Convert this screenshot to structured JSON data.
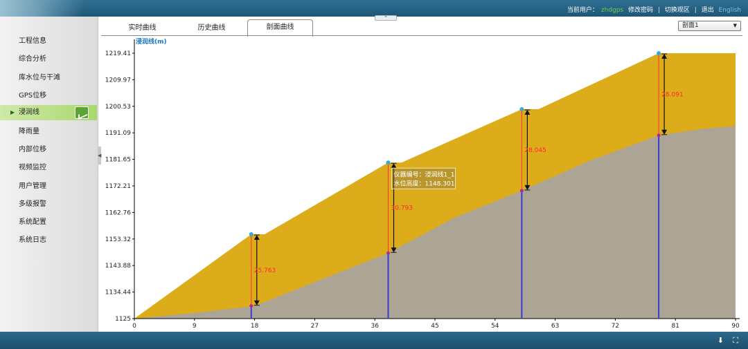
{
  "header": {
    "user_label": "当前用户：",
    "user_name": "zhdgps",
    "change_password": "修改密码",
    "switch_area": "切换观区",
    "logout": "退出",
    "language": "English",
    "separator": "|",
    "collapse_glyph": "⌃"
  },
  "sidebar": {
    "items": [
      {
        "label": "工程信息"
      },
      {
        "label": "综合分析"
      },
      {
        "label": "库水位与干滩"
      },
      {
        "label": "GPS位移"
      },
      {
        "label": "浸润线",
        "active": true
      },
      {
        "label": "降雨量"
      },
      {
        "label": "内部位移"
      },
      {
        "label": "视频监控"
      },
      {
        "label": "用户管理"
      },
      {
        "label": "多级报警"
      },
      {
        "label": "系统配置"
      },
      {
        "label": "系统日志"
      }
    ],
    "active_arrow": "▶",
    "handle_glyph": "◀"
  },
  "tabs": {
    "items": [
      "实时曲线",
      "历史曲线",
      "剖面曲线"
    ],
    "active_index": 2
  },
  "section_select": {
    "value": "剖面1",
    "chevron": "▼"
  },
  "chart_data": {
    "type": "area",
    "ylabel": "浸润线(m)",
    "xlim": [
      0,
      90
    ],
    "ylim": [
      1125,
      1219.41
    ],
    "x_ticks": [
      "0",
      "9",
      "18",
      "27",
      "36",
      "45",
      "54",
      "63",
      "72",
      "81",
      "90"
    ],
    "y_ticks": [
      "1125",
      "1134.44",
      "1143.88",
      "1153.32",
      "1162.76",
      "1172.21",
      "1181.65",
      "1191.09",
      "1200.53",
      "1209.97",
      "1219.41"
    ],
    "dam_surface": {
      "x": [
        0,
        17.5,
        19.5,
        38,
        40,
        58,
        60.5,
        78.5,
        90
      ],
      "y": [
        1125,
        1155,
        1155,
        1180.5,
        1180.5,
        1199.5,
        1199.5,
        1219.41,
        1219.41
      ]
    },
    "phreatic_line": {
      "x": [
        0,
        9,
        18,
        27,
        38,
        48,
        58,
        68,
        78.5,
        85,
        90
      ],
      "y": [
        1125,
        1127,
        1129.5,
        1138,
        1148.3,
        1161,
        1170.5,
        1181,
        1190.2,
        1192.5,
        1193.5
      ]
    },
    "instruments": [
      {
        "x": 17.5,
        "top": 1155,
        "water": 1129.5,
        "depth": "25.763"
      },
      {
        "x": 38,
        "top": 1180.5,
        "water": 1148.301,
        "depth": "30.793"
      },
      {
        "x": 58,
        "top": 1199.5,
        "water": 1170.5,
        "depth": "28.045"
      },
      {
        "x": 78.5,
        "top": 1219.41,
        "water": 1190.2,
        "depth": "28.091"
      }
    ],
    "tooltip": {
      "line1": "仪器编号：浸润线1_1",
      "line2": "水位高度：1148.301"
    },
    "colors": {
      "dam": "#dcac1a",
      "ground": "#aca595",
      "dot": "#3aa7d6",
      "vertical": "#3a3ad0",
      "depth_line": "#ff3030",
      "arrow": "#111111"
    }
  },
  "footer": {
    "icon_download": "⬇",
    "icon_fullscreen": "⛶"
  }
}
